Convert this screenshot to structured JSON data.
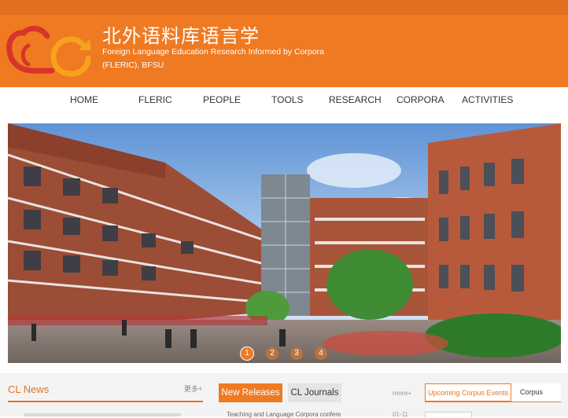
{
  "header": {
    "title": "北外语料库语言学",
    "subtitle": "Foreign Language Education Research Informed by Corpora (FLERIC), BFSU",
    "logo_icon": "cc-refresh-logo-icon",
    "brand_color": "#ef7a22",
    "logo_red": "#d9342b"
  },
  "nav": {
    "items": [
      "HOME",
      "FLERIC",
      "PEOPLE",
      "TOOLS",
      "RESEARCH",
      "CORPORA",
      "ACTIVITIES"
    ]
  },
  "hero": {
    "slides": [
      "1",
      "2",
      "3",
      "4"
    ],
    "active_slide": 1
  },
  "news": {
    "title": "CL News",
    "more": "更多+"
  },
  "releases": {
    "tabs": [
      "New Releases",
      "CL Journals"
    ],
    "active_tab": "New Releases",
    "more": "more+",
    "first_item": "Teaching and Language Corpora confere",
    "first_date": "01-11"
  },
  "events": {
    "tabs": [
      "Upcoming Corpus Events",
      "Corpus"
    ],
    "active_tab": "Upcoming Corpus Events"
  }
}
